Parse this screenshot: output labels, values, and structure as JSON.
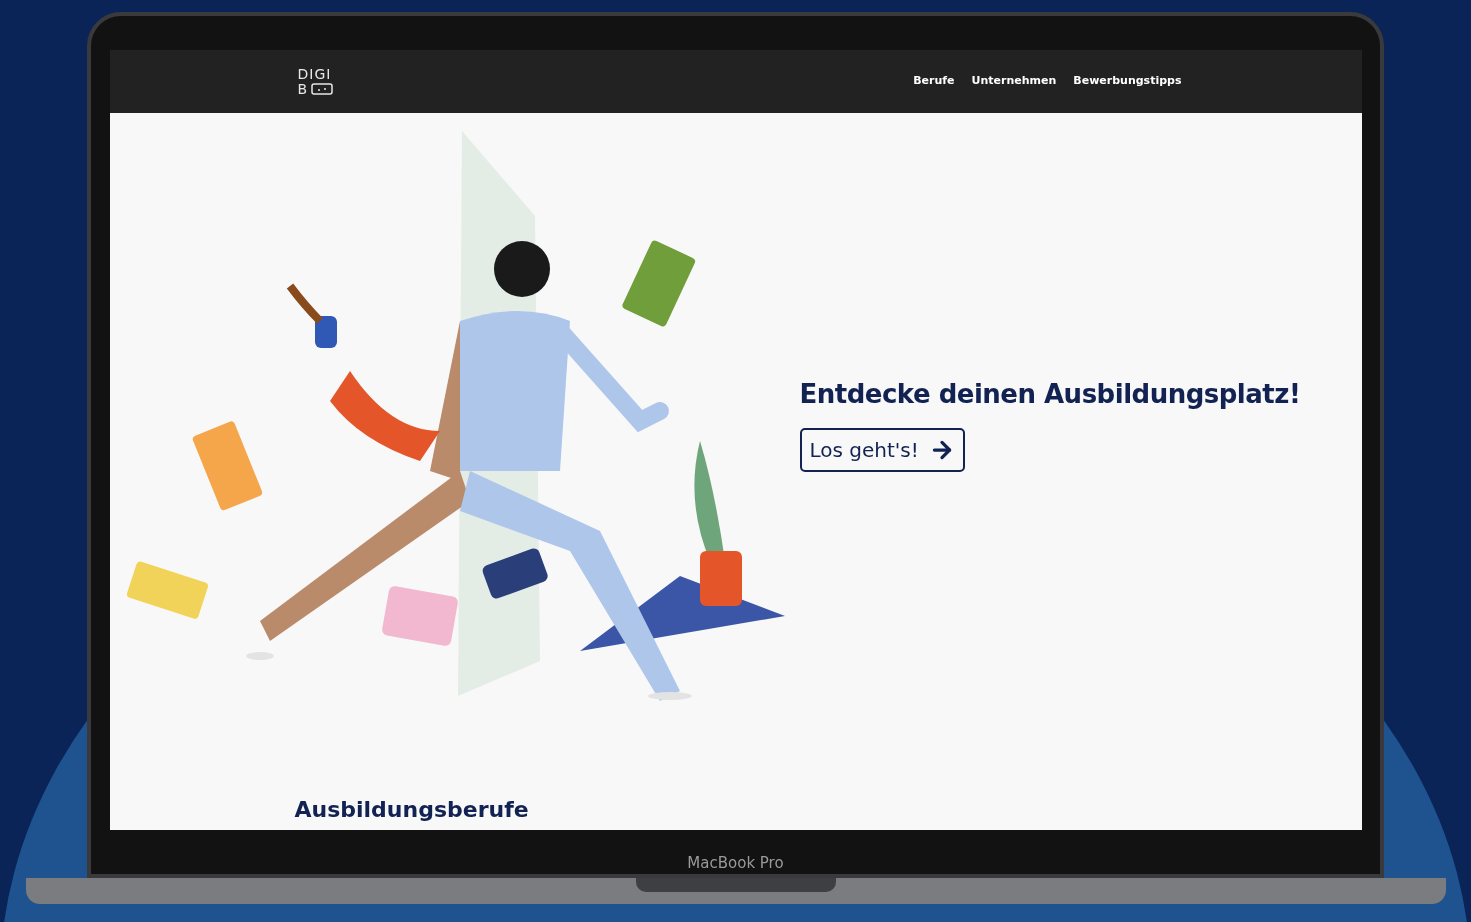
{
  "site": {
    "logo": {
      "line_1": "DIGI",
      "line_2": "B"
    },
    "nav": [
      {
        "label": "Berufe"
      },
      {
        "label": "Unternehmen"
      },
      {
        "label": "Bewerbungstipps"
      }
    ],
    "hero": {
      "heading": "Entdecke deinen Ausbildungsplatz!",
      "button": "Los geht's!"
    },
    "section_heading": "Ausbildungsberufe"
  },
  "device_label": "MacBook Pro"
}
